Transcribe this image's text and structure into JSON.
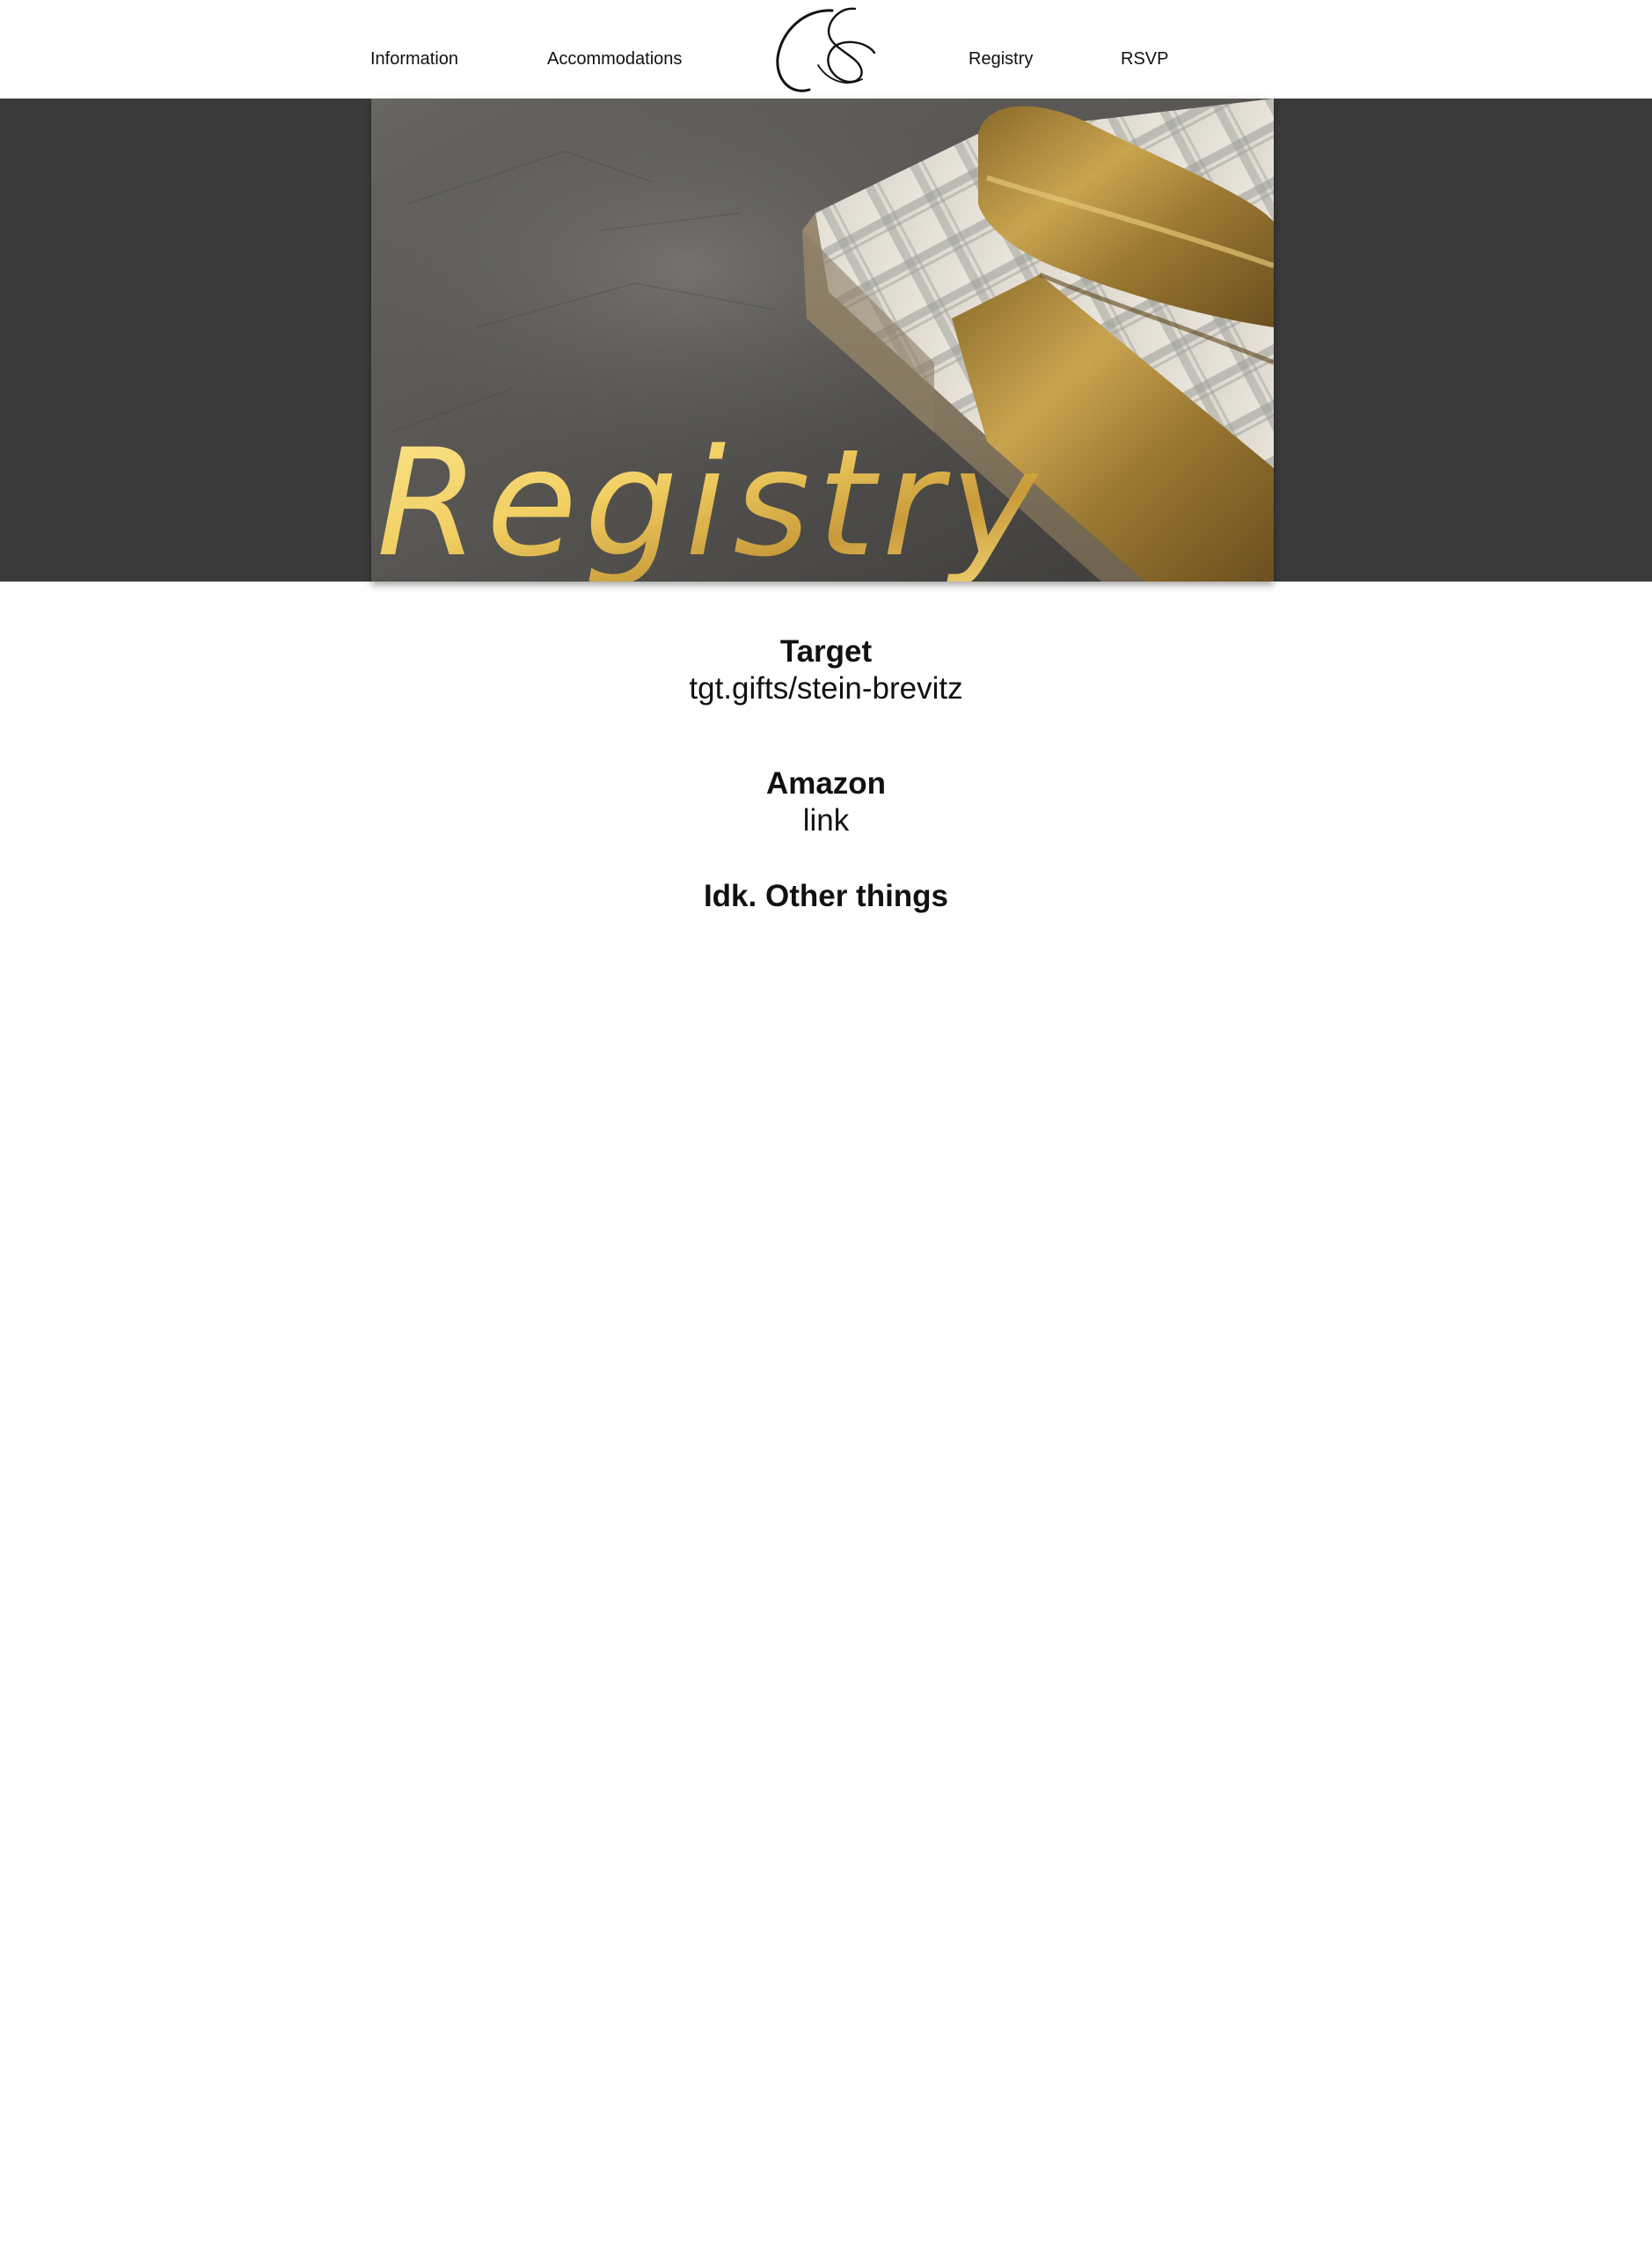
{
  "nav": {
    "left": [
      {
        "label": "Information"
      },
      {
        "label": "Accommodations"
      }
    ],
    "right": [
      {
        "label": "Registry"
      },
      {
        "label": "RSVP"
      }
    ],
    "logo_icon": "ampersand-logo-icon"
  },
  "hero": {
    "title": "Registry",
    "band_color": "#3a3a3a",
    "title_color": "#f2d06b"
  },
  "registries": [
    {
      "name": "Target",
      "link_text": "tgt.gifts/stein-brevitz"
    },
    {
      "name": "Amazon",
      "link_text": "link"
    },
    {
      "name": "Idk. Other things"
    }
  ]
}
